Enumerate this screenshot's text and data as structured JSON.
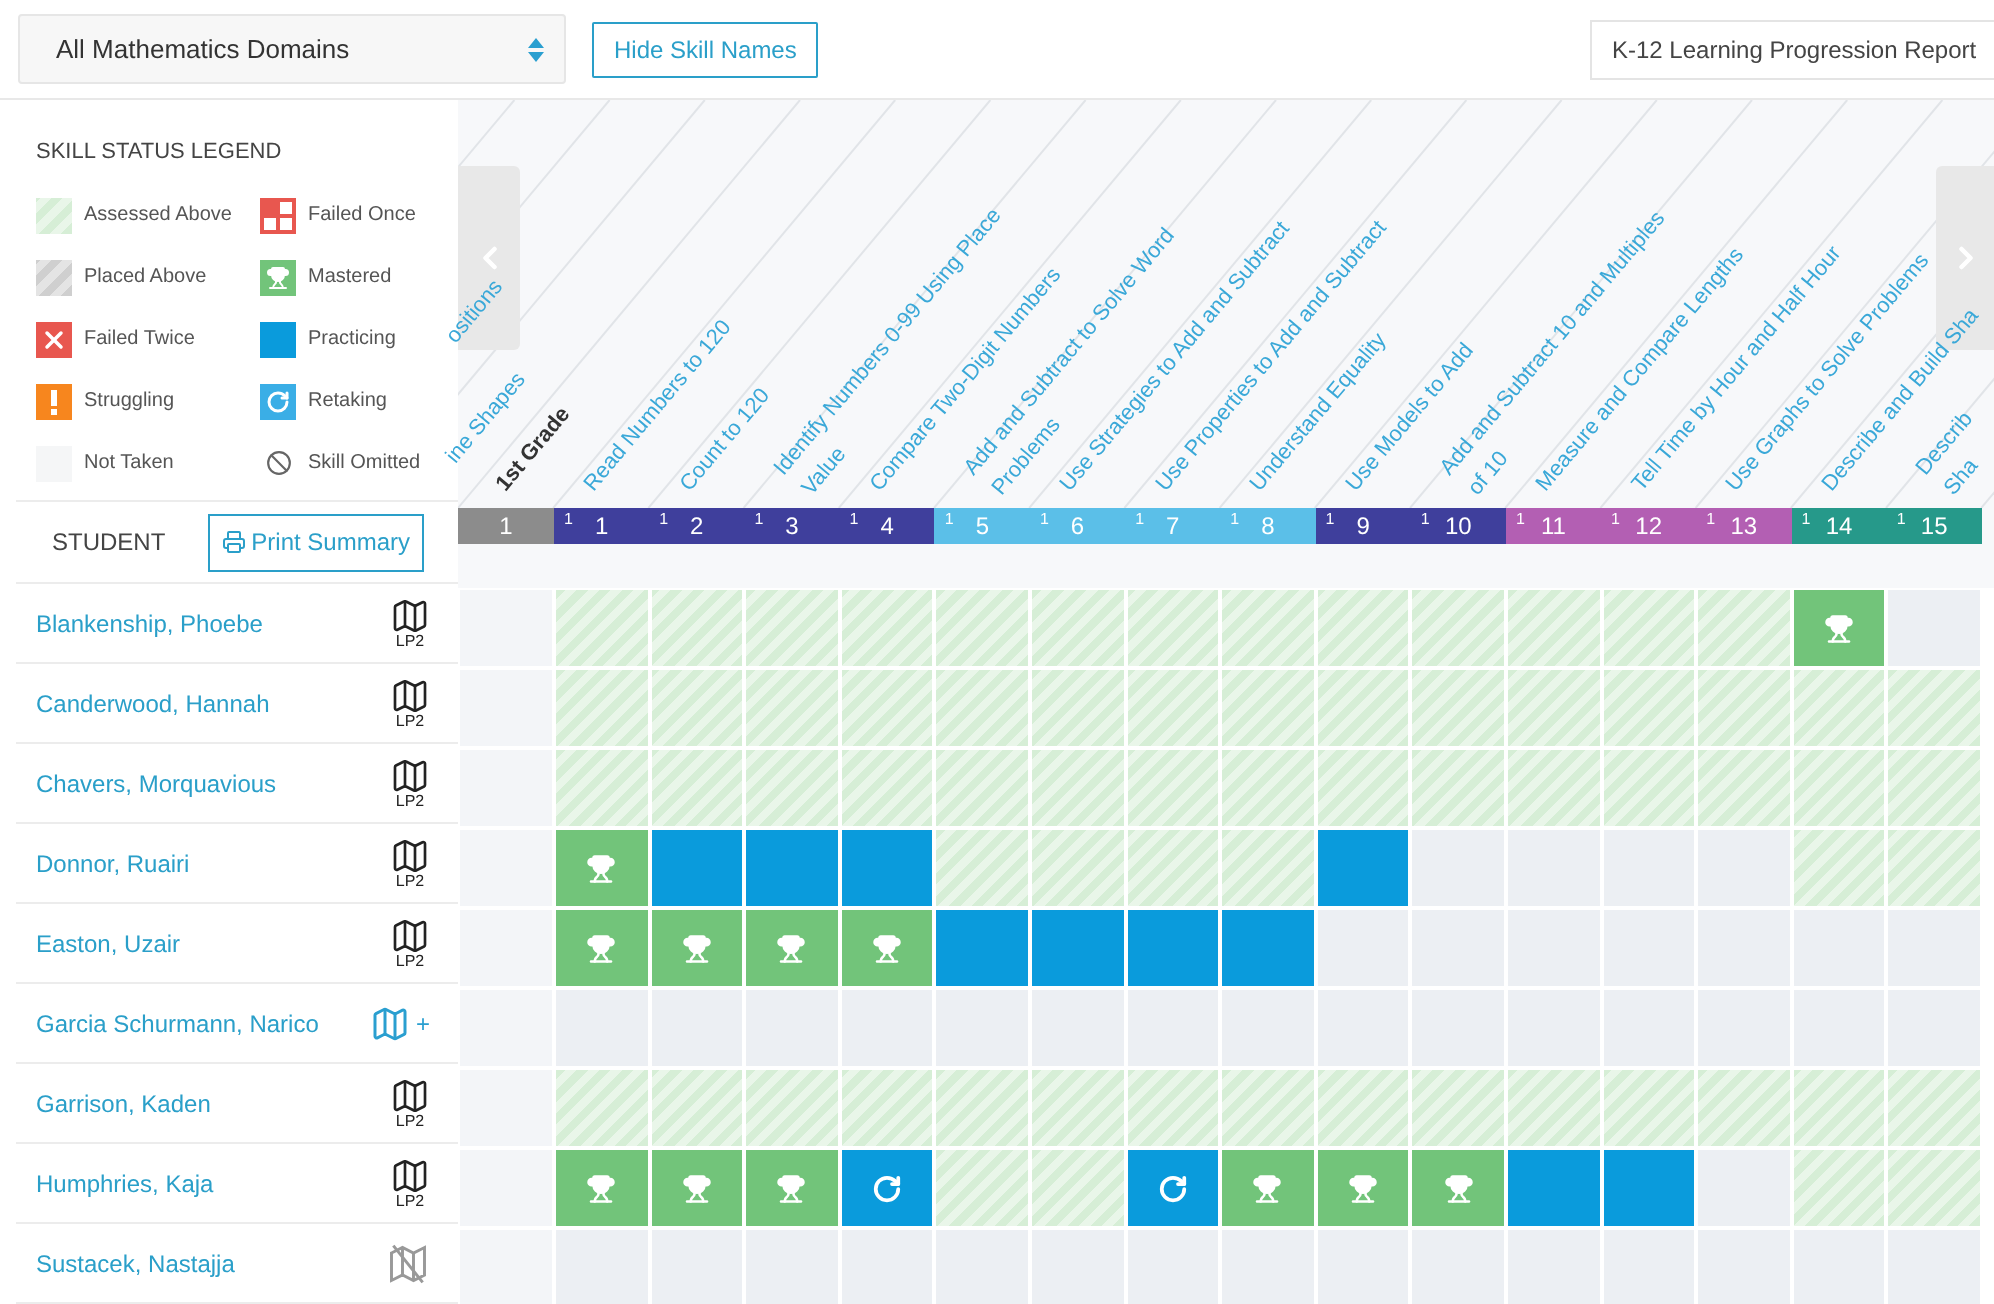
{
  "toolbar": {
    "domain_select": {
      "value": "All Mathematics Domains"
    },
    "hide_button": "Hide Skill Names",
    "report_button": "K-12 Learning Progression Report"
  },
  "legend": {
    "title": "SKILL STATUS LEGEND",
    "items": [
      {
        "kind": "assessed",
        "label": "Assessed Above"
      },
      {
        "kind": "failed_once",
        "label": "Failed Once"
      },
      {
        "kind": "placed",
        "label": "Placed Above"
      },
      {
        "kind": "mastered",
        "label": "Mastered"
      },
      {
        "kind": "failed_twice",
        "label": "Failed Twice"
      },
      {
        "kind": "practicing",
        "label": "Practicing"
      },
      {
        "kind": "struggling",
        "label": "Struggling"
      },
      {
        "kind": "retaking",
        "label": "Retaking"
      },
      {
        "kind": "not_taken",
        "label": "Not Taken"
      },
      {
        "kind": "omitted",
        "label": "Skill Omitted"
      }
    ]
  },
  "student_header": {
    "label": "STUDENT",
    "print_button": "Print Summary"
  },
  "partial_labels": [
    "ine Shapes",
    "ositions"
  ],
  "columns": [
    {
      "kind": "grade",
      "number": "1",
      "color": "#8c8c8c",
      "label": [
        "1st Grade"
      ]
    },
    {
      "kind": "skill",
      "grade_mark": "1",
      "number": "1",
      "color": "#3f3f9c",
      "label": [
        "Read Numbers to 120"
      ]
    },
    {
      "kind": "skill",
      "grade_mark": "1",
      "number": "2",
      "color": "#3f3f9c",
      "label": [
        "Count to 120"
      ]
    },
    {
      "kind": "skill",
      "grade_mark": "1",
      "number": "3",
      "color": "#3f3f9c",
      "label": [
        "Identify Numbers 0-99 Using Place",
        "Value"
      ]
    },
    {
      "kind": "skill",
      "grade_mark": "1",
      "number": "4",
      "color": "#3f3f9c",
      "label": [
        "Compare Two-Digit Numbers"
      ]
    },
    {
      "kind": "skill",
      "grade_mark": "1",
      "number": "5",
      "color": "#5bbfe8",
      "label": [
        "Add and Subtract to Solve Word",
        "Problems"
      ]
    },
    {
      "kind": "skill",
      "grade_mark": "1",
      "number": "6",
      "color": "#5bbfe8",
      "label": [
        "Use Strategies to Add and Subtract"
      ]
    },
    {
      "kind": "skill",
      "grade_mark": "1",
      "number": "7",
      "color": "#5bbfe8",
      "label": [
        "Use Properties to Add and Subtract"
      ]
    },
    {
      "kind": "skill",
      "grade_mark": "1",
      "number": "8",
      "color": "#5bbfe8",
      "label": [
        "Understand Equality"
      ]
    },
    {
      "kind": "skill",
      "grade_mark": "1",
      "number": "9",
      "color": "#3f3f9c",
      "label": [
        "Use Models to Add"
      ]
    },
    {
      "kind": "skill",
      "grade_mark": "1",
      "number": "10",
      "color": "#3f3f9c",
      "label": [
        "Add and Subtract 10 and Multiples",
        "of 10"
      ]
    },
    {
      "kind": "skill",
      "grade_mark": "1",
      "number": "11",
      "color": "#b35fb3",
      "label": [
        "Measure and Compare Lengths"
      ]
    },
    {
      "kind": "skill",
      "grade_mark": "1",
      "number": "12",
      "color": "#b35fb3",
      "label": [
        "Tell Time by Hour and Half Hour"
      ]
    },
    {
      "kind": "skill",
      "grade_mark": "1",
      "number": "13",
      "color": "#b35fb3",
      "label": [
        "Use Graphs to Solve Problems"
      ]
    },
    {
      "kind": "skill",
      "grade_mark": "1",
      "number": "14",
      "color": "#26998a",
      "label": [
        "Describe and Build Sha"
      ]
    },
    {
      "kind": "skill",
      "grade_mark": "1",
      "number": "15",
      "color": "#26998a",
      "label": [
        "Describ",
        "Sha"
      ]
    }
  ],
  "students": [
    {
      "name": "Blankenship, Phoebe",
      "plan": {
        "kind": "lp",
        "badge": "LP2"
      },
      "cells": [
        {
          "kind": "assessed"
        },
        {
          "kind": "assessed"
        },
        {
          "kind": "assessed"
        },
        {
          "kind": "assessed"
        },
        {
          "kind": "assessed"
        },
        {
          "kind": "assessed"
        },
        {
          "kind": "assessed"
        },
        {
          "kind": "assessed"
        },
        {
          "kind": "assessed"
        },
        {
          "kind": "assessed"
        },
        {
          "kind": "assessed"
        },
        {
          "kind": "assessed"
        },
        {
          "kind": "assessed"
        },
        {
          "kind": "mastered"
        },
        {
          "kind": "empty"
        }
      ]
    },
    {
      "name": "Canderwood, Hannah",
      "plan": {
        "kind": "lp",
        "badge": "LP2"
      },
      "cells": [
        {
          "kind": "assessed"
        },
        {
          "kind": "assessed"
        },
        {
          "kind": "assessed"
        },
        {
          "kind": "assessed"
        },
        {
          "kind": "assessed"
        },
        {
          "kind": "assessed"
        },
        {
          "kind": "assessed"
        },
        {
          "kind": "assessed"
        },
        {
          "kind": "assessed"
        },
        {
          "kind": "assessed"
        },
        {
          "kind": "assessed"
        },
        {
          "kind": "assessed"
        },
        {
          "kind": "assessed"
        },
        {
          "kind": "assessed"
        },
        {
          "kind": "assessed"
        }
      ]
    },
    {
      "name": "Chavers, Morquavious",
      "plan": {
        "kind": "lp",
        "badge": "LP2"
      },
      "cells": [
        {
          "kind": "assessed"
        },
        {
          "kind": "assessed"
        },
        {
          "kind": "assessed"
        },
        {
          "kind": "assessed"
        },
        {
          "kind": "assessed"
        },
        {
          "kind": "assessed"
        },
        {
          "kind": "assessed"
        },
        {
          "kind": "assessed"
        },
        {
          "kind": "assessed"
        },
        {
          "kind": "assessed"
        },
        {
          "kind": "assessed"
        },
        {
          "kind": "assessed"
        },
        {
          "kind": "assessed"
        },
        {
          "kind": "assessed"
        },
        {
          "kind": "assessed"
        }
      ]
    },
    {
      "name": "Donnor, Ruairi",
      "plan": {
        "kind": "lp",
        "badge": "LP2"
      },
      "cells": [
        {
          "kind": "mastered"
        },
        {
          "kind": "practicing"
        },
        {
          "kind": "practicing"
        },
        {
          "kind": "practicing"
        },
        {
          "kind": "assessed"
        },
        {
          "kind": "assessed"
        },
        {
          "kind": "assessed"
        },
        {
          "kind": "assessed"
        },
        {
          "kind": "practicing"
        },
        {
          "kind": "empty"
        },
        {
          "kind": "empty"
        },
        {
          "kind": "empty"
        },
        {
          "kind": "empty"
        },
        {
          "kind": "assessed"
        },
        {
          "kind": "assessed"
        }
      ]
    },
    {
      "name": "Easton, Uzair",
      "plan": {
        "kind": "lp",
        "badge": "LP2"
      },
      "cells": [
        {
          "kind": "mastered"
        },
        {
          "kind": "mastered"
        },
        {
          "kind": "mastered"
        },
        {
          "kind": "mastered"
        },
        {
          "kind": "practicing"
        },
        {
          "kind": "practicing"
        },
        {
          "kind": "practicing"
        },
        {
          "kind": "practicing"
        },
        {
          "kind": "empty"
        },
        {
          "kind": "empty"
        },
        {
          "kind": "empty"
        },
        {
          "kind": "empty"
        },
        {
          "kind": "empty"
        },
        {
          "kind": "empty"
        },
        {
          "kind": "empty"
        }
      ]
    },
    {
      "name": "Garcia Schurmann, Narico",
      "plan": {
        "kind": "add",
        "badge": "+"
      },
      "cells": [
        {
          "kind": "empty"
        },
        {
          "kind": "empty"
        },
        {
          "kind": "empty"
        },
        {
          "kind": "empty"
        },
        {
          "kind": "empty"
        },
        {
          "kind": "empty"
        },
        {
          "kind": "empty"
        },
        {
          "kind": "empty"
        },
        {
          "kind": "empty"
        },
        {
          "kind": "empty"
        },
        {
          "kind": "empty"
        },
        {
          "kind": "empty"
        },
        {
          "kind": "empty"
        },
        {
          "kind": "empty"
        },
        {
          "kind": "empty"
        }
      ]
    },
    {
      "name": "Garrison, Kaden",
      "plan": {
        "kind": "lp",
        "badge": "LP2"
      },
      "cells": [
        {
          "kind": "assessed"
        },
        {
          "kind": "assessed"
        },
        {
          "kind": "assessed"
        },
        {
          "kind": "assessed"
        },
        {
          "kind": "assessed"
        },
        {
          "kind": "assessed"
        },
        {
          "kind": "assessed"
        },
        {
          "kind": "assessed"
        },
        {
          "kind": "assessed"
        },
        {
          "kind": "assessed"
        },
        {
          "kind": "assessed"
        },
        {
          "kind": "assessed"
        },
        {
          "kind": "assessed"
        },
        {
          "kind": "assessed"
        },
        {
          "kind": "assessed"
        }
      ]
    },
    {
      "name": "Humphries, Kaja",
      "plan": {
        "kind": "lp",
        "badge": "LP2"
      },
      "cells": [
        {
          "kind": "mastered"
        },
        {
          "kind": "mastered"
        },
        {
          "kind": "mastered"
        },
        {
          "kind": "retaking"
        },
        {
          "kind": "assessed"
        },
        {
          "kind": "assessed"
        },
        {
          "kind": "retaking"
        },
        {
          "kind": "mastered"
        },
        {
          "kind": "mastered"
        },
        {
          "kind": "mastered"
        },
        {
          "kind": "practicing"
        },
        {
          "kind": "practicing"
        },
        {
          "kind": "empty"
        },
        {
          "kind": "assessed"
        },
        {
          "kind": "assessed"
        }
      ]
    },
    {
      "name": "Sustacek, Nastajja",
      "plan": {
        "kind": "none"
      },
      "cells": [
        {
          "kind": "empty"
        },
        {
          "kind": "empty"
        },
        {
          "kind": "empty"
        },
        {
          "kind": "empty"
        },
        {
          "kind": "empty"
        },
        {
          "kind": "empty"
        },
        {
          "kind": "empty"
        },
        {
          "kind": "empty"
        },
        {
          "kind": "empty"
        },
        {
          "kind": "empty"
        },
        {
          "kind": "empty"
        },
        {
          "kind": "empty"
        },
        {
          "kind": "empty"
        },
        {
          "kind": "empty"
        },
        {
          "kind": "empty"
        }
      ]
    }
  ]
}
